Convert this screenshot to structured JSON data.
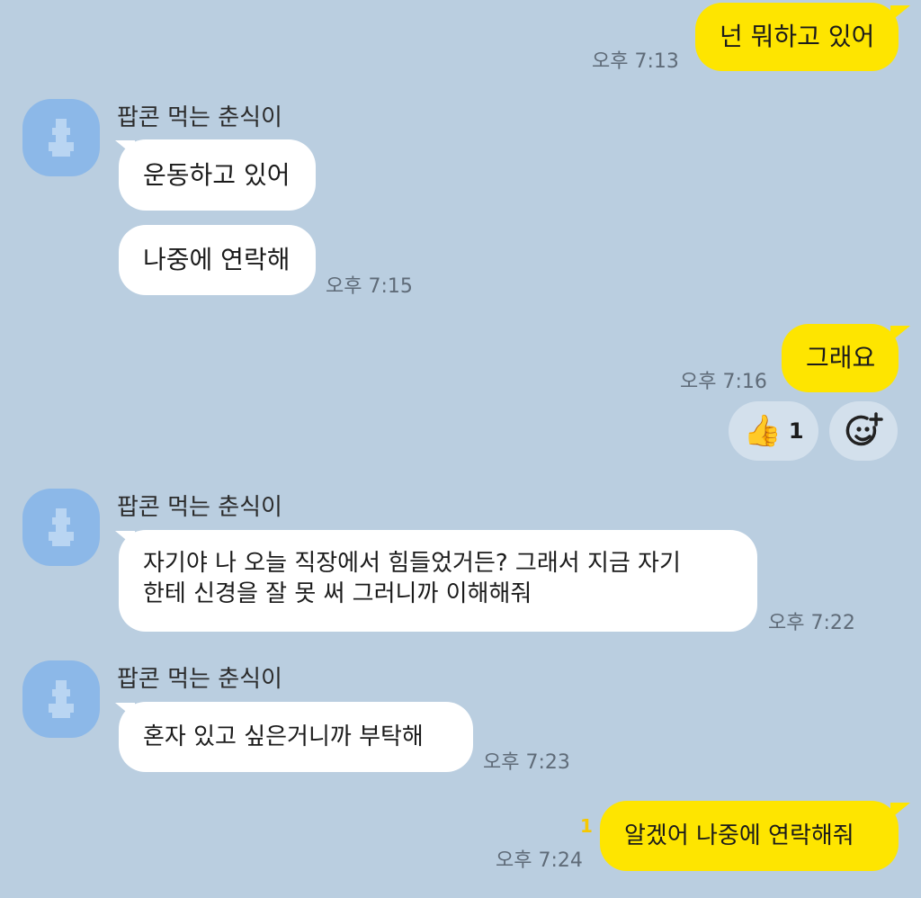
{
  "chat": {
    "sender_name": "팝콘 먹는 춘식이",
    "messages": [
      {
        "text": "넌 뭐하고 있어",
        "time": "오후 7:13"
      },
      {
        "text": "운동하고 있어"
      },
      {
        "text": "나중에 연락해",
        "time": "오후 7:15"
      },
      {
        "text": "그래요",
        "time": "오후 7:16"
      },
      {
        "text": "자기야 나 오늘 직장에서 힘들었거든? 그래서 지금 자기\n한테 신경을 잘 못 써 그러니까 이해해줘",
        "time": "오후 7:22"
      },
      {
        "text": "혼자 있고 싶은거니까 부탁해",
        "time": "오후 7:23"
      },
      {
        "text": "알겠어 나중에 연락해줘",
        "time": "오후 7:24",
        "unread": "1"
      }
    ],
    "reaction": {
      "emoji": "👍",
      "count": "1",
      "icon": "thumbs-up-icon"
    },
    "add_reaction_icon": "add-emoji-icon",
    "colors": {
      "background": "#bacee0",
      "my_bubble": "#fee500",
      "their_bubble": "#ffffff",
      "avatar": "#8cb8e8",
      "unread": "#f6c800"
    }
  }
}
